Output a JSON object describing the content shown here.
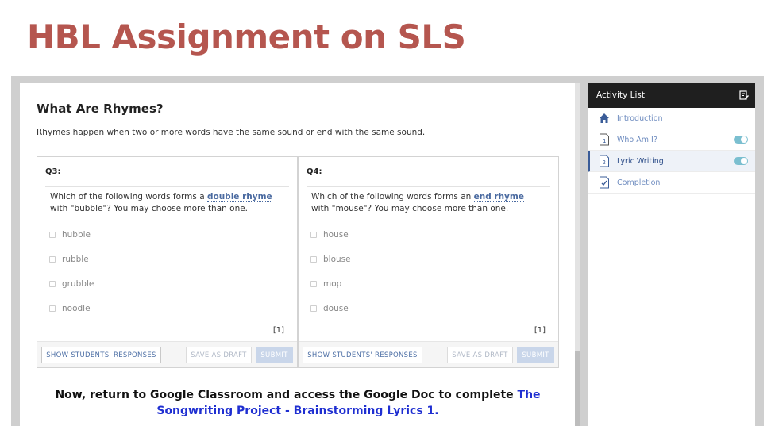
{
  "slide": {
    "title": "HBL Assignment on SLS"
  },
  "main": {
    "heading": "What Are Rhymes?",
    "description": "Rhymes happen when two or more words have the same sound or end with the same sound."
  },
  "questions": [
    {
      "number": "Q3:",
      "prompt_before": "Which of the following words forms a ",
      "keyword": "double rhyme",
      "prompt_after": " with \"bubble\"? You may choose more than one.",
      "options": [
        "hubble",
        "rubble",
        "grubble",
        "noodle"
      ],
      "marks": "[1]",
      "buttons": {
        "show": "SHOW STUDENTS' RESPONSES",
        "draft": "SAVE AS DRAFT",
        "submit": "SUBMIT"
      }
    },
    {
      "number": "Q4:",
      "prompt_before": "Which of the following words forms an ",
      "keyword": "end rhyme",
      "prompt_after": " with \"mouse\"? You may choose more than one.",
      "options": [
        "house",
        "blouse",
        "mop",
        "douse"
      ],
      "marks": "[1]",
      "buttons": {
        "show": "SHOW STUDENTS' RESPONSES",
        "draft": "SAVE AS DRAFT",
        "submit": "SUBMIT"
      }
    }
  ],
  "instruction": {
    "text": "Now, return to Google Classroom and access the Google Doc to complete ",
    "link": "The Songwriting Project - Brainstorming Lyrics 1."
  },
  "activity_list": {
    "title": "Activity List",
    "items": [
      {
        "label": "Introduction",
        "icon": "home-icon",
        "toggle": false,
        "active": false
      },
      {
        "label": "Who Am I?",
        "icon": "page-1-icon",
        "toggle": true,
        "active": false
      },
      {
        "label": "Lyric Writing",
        "icon": "page-2-icon",
        "toggle": true,
        "active": true
      },
      {
        "label": "Completion",
        "icon": "completion-check-icon",
        "toggle": false,
        "active": false
      }
    ]
  },
  "colors": {
    "title": "#b5564f",
    "keyword": "#4a6aa0",
    "link": "#1f2fd1",
    "toggle": "#7bbfd0",
    "activity_header": "#1f1f1f"
  }
}
